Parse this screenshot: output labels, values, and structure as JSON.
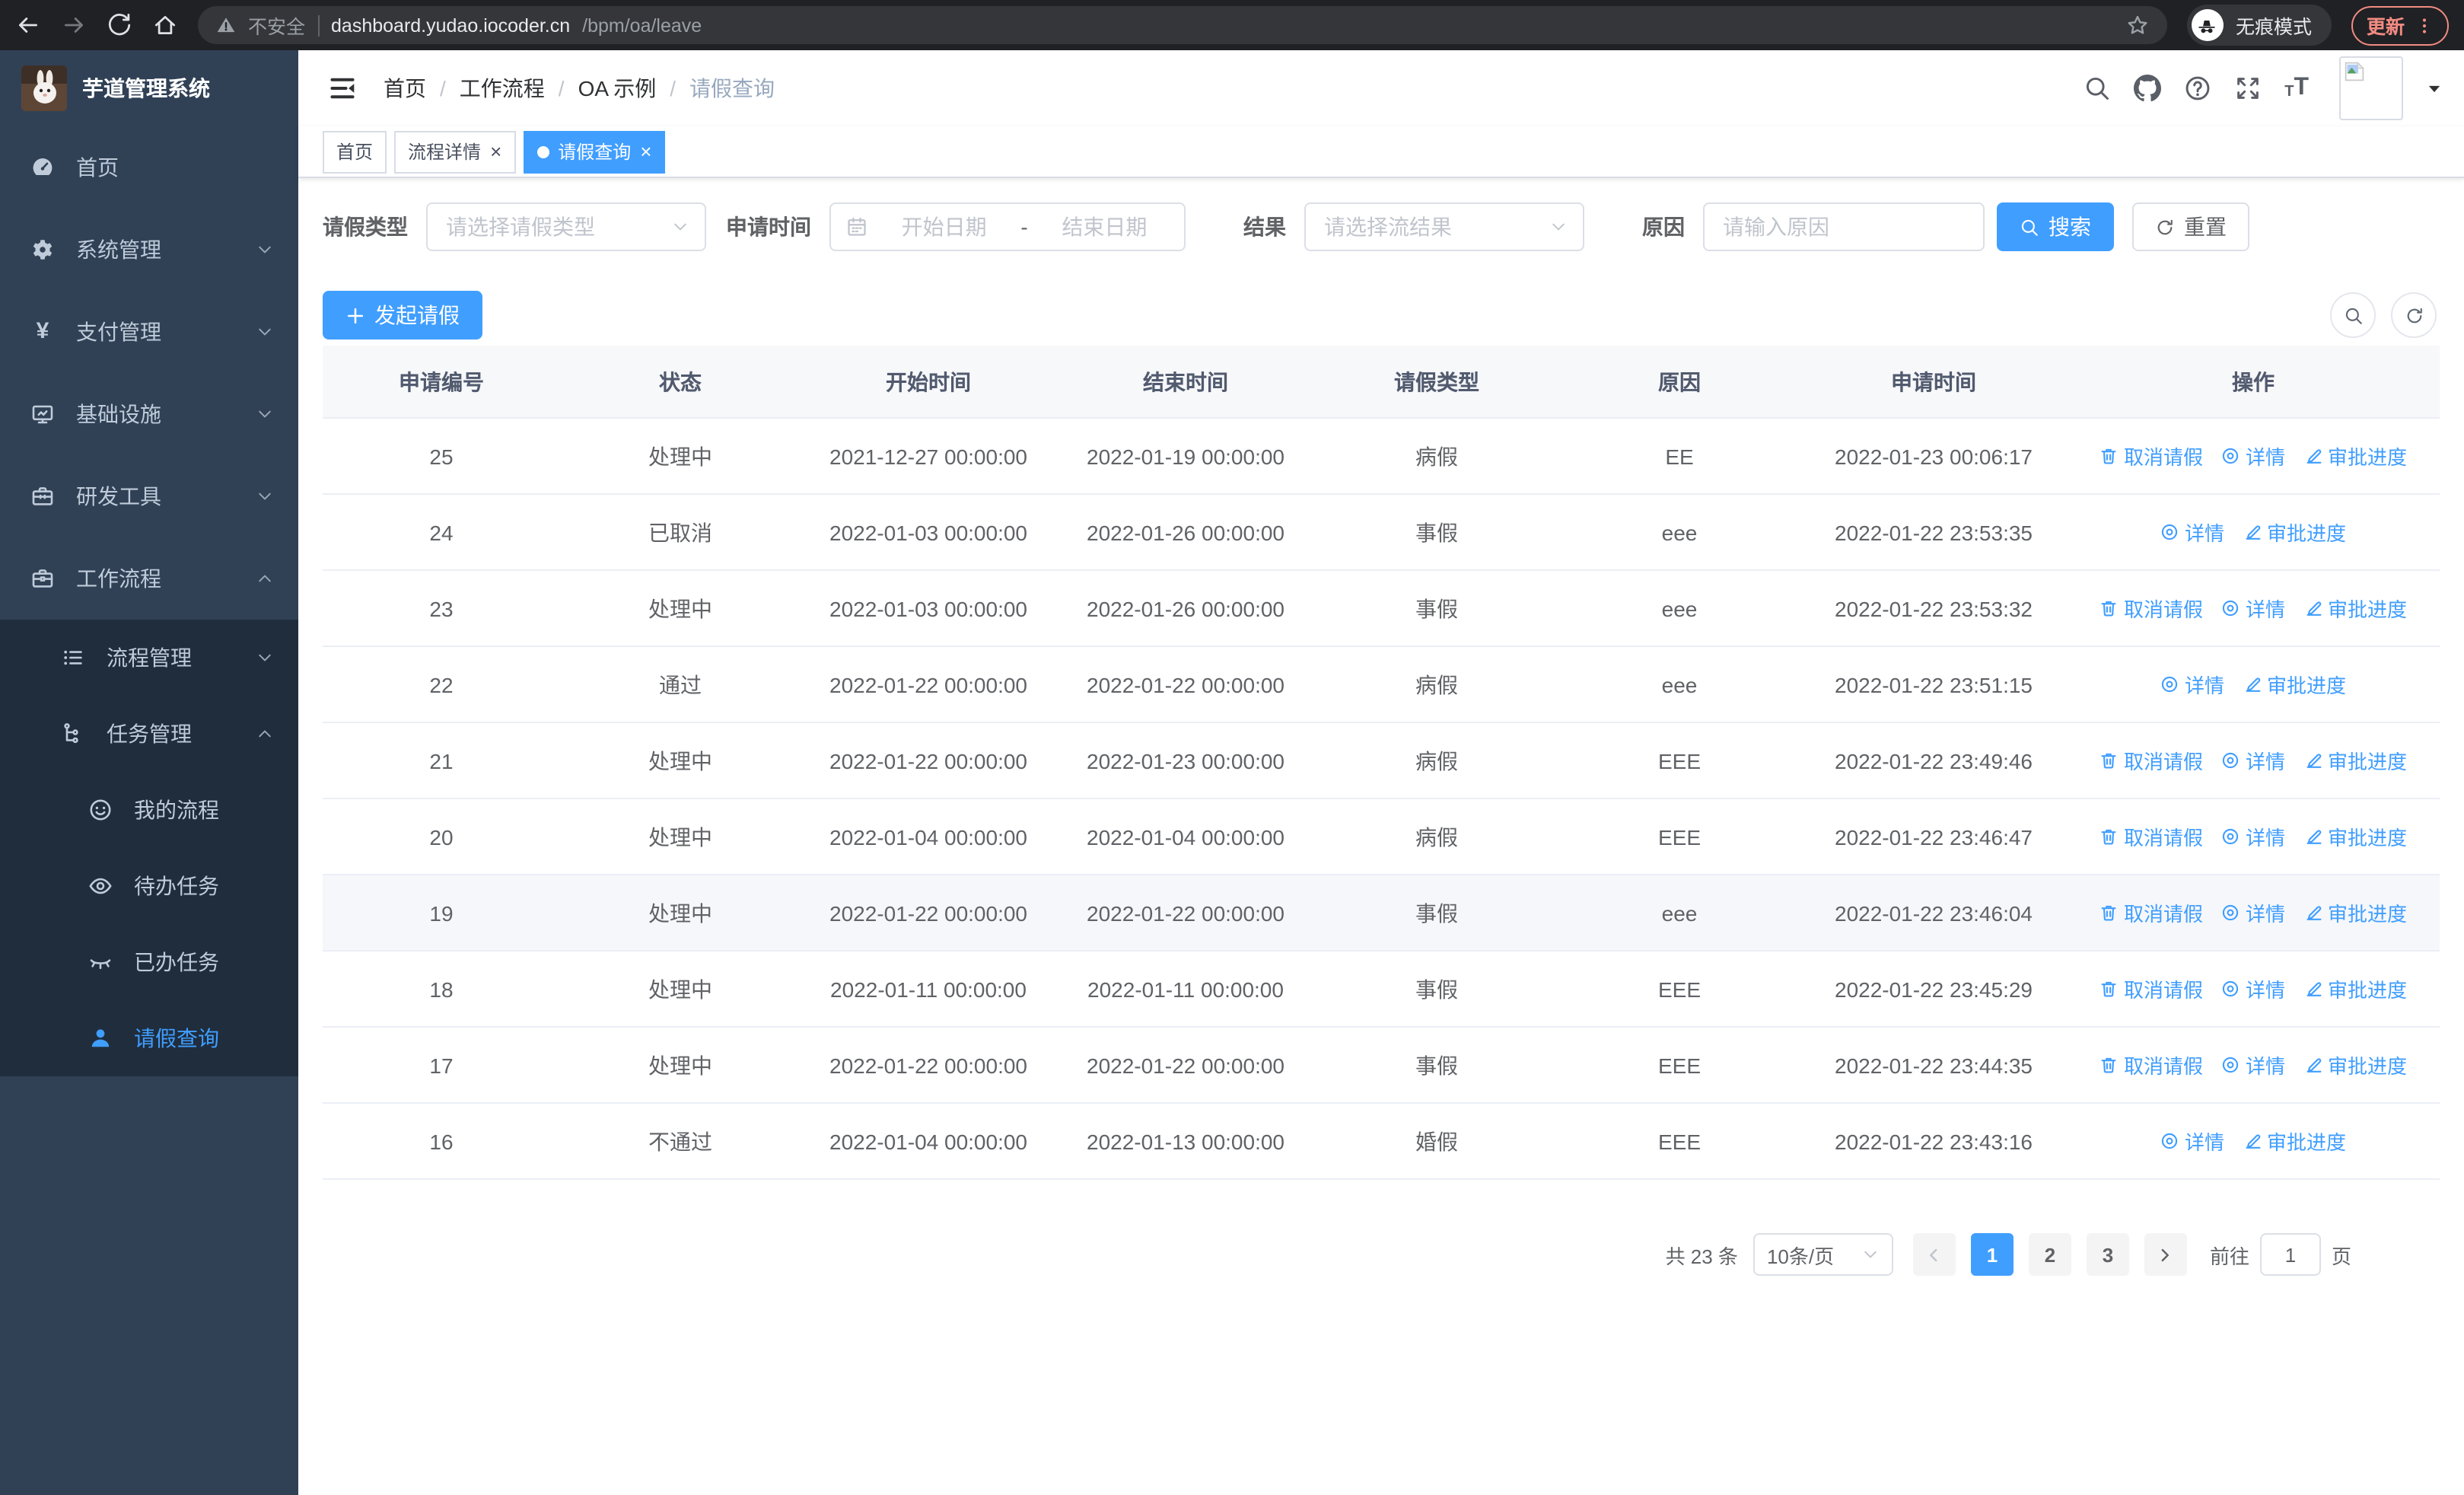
{
  "colors": {
    "accent": "#409eff",
    "sidebar_bg": "#304156",
    "submenu_bg": "#1f2d3d",
    "sidebar_text": "#bfcbd9",
    "update_badge": "#f28b82",
    "table_border": "#ebeef5"
  },
  "browser": {
    "not_secure_label": "不安全",
    "url_host": "dashboard.yudao.iocoder.cn",
    "url_path": "/bpm/oa/leave",
    "incognito_label": "无痕模式",
    "update_label": "更新"
  },
  "sidebar": {
    "title": "芋道管理系统",
    "items": [
      {
        "label": "首页",
        "icon": "dashboard",
        "level": 1
      },
      {
        "label": "系统管理",
        "icon": "gear",
        "level": 1,
        "arrow": "down"
      },
      {
        "label": "支付管理",
        "icon": "yen",
        "level": 1,
        "arrow": "down"
      },
      {
        "label": "基础设施",
        "icon": "monitor",
        "level": 1,
        "arrow": "down"
      },
      {
        "label": "研发工具",
        "icon": "toolbox",
        "level": 1,
        "arrow": "down"
      },
      {
        "label": "工作流程",
        "icon": "briefcase",
        "level": 1,
        "arrow": "up"
      },
      {
        "label": "流程管理",
        "icon": "list",
        "level": 2,
        "sub": true,
        "arrow": "down"
      },
      {
        "label": "任务管理",
        "icon": "tree",
        "level": 2,
        "sub": true,
        "arrow": "up"
      },
      {
        "label": "我的流程",
        "icon": "face",
        "level": 3,
        "sub": true
      },
      {
        "label": "待办任务",
        "icon": "eye",
        "level": 3,
        "sub": true
      },
      {
        "label": "已办任务",
        "icon": "eye-closed",
        "level": 3,
        "sub": true
      },
      {
        "label": "请假查询",
        "icon": "user",
        "level": 3,
        "sub": true,
        "active": true
      }
    ]
  },
  "breadcrumb": [
    {
      "label": "首页"
    },
    {
      "label": "工作流程"
    },
    {
      "label": "OA 示例"
    },
    {
      "label": "请假查询",
      "current": true
    }
  ],
  "tabs": [
    {
      "label": "首页",
      "closable": false,
      "active": false
    },
    {
      "label": "流程详情",
      "closable": true,
      "active": false
    },
    {
      "label": "请假查询",
      "closable": true,
      "active": true
    }
  ],
  "filters": {
    "leave_type_label": "请假类型",
    "leave_type_placeholder": "请选择请假类型",
    "apply_time_label": "申请时间",
    "start_date_placeholder": "开始日期",
    "range_separator": "-",
    "end_date_placeholder": "结束日期",
    "result_label": "结果",
    "result_placeholder": "请选择流结果",
    "reason_label": "原因",
    "reason_placeholder": "请输入原因",
    "search_label": "搜索",
    "reset_label": "重置"
  },
  "toolbar": {
    "create_label": "发起请假"
  },
  "table": {
    "columns": [
      "申请编号",
      "状态",
      "开始时间",
      "结束时间",
      "请假类型",
      "原因",
      "申请时间",
      "操作"
    ],
    "action_defs": {
      "cancel": {
        "label": "取消请假",
        "icon": "delete"
      },
      "detail": {
        "label": "详情",
        "icon": "view"
      },
      "progress": {
        "label": "审批进度",
        "icon": "edit"
      }
    },
    "rows": [
      {
        "id": "25",
        "status": "处理中",
        "start": "2021-12-27 00:00:00",
        "end": "2022-01-19 00:00:00",
        "type": "病假",
        "reason": "EE",
        "apply": "2022-01-23 00:06:17",
        "actions": [
          "cancel",
          "detail",
          "progress"
        ]
      },
      {
        "id": "24",
        "status": "已取消",
        "start": "2022-01-03 00:00:00",
        "end": "2022-01-26 00:00:00",
        "type": "事假",
        "reason": "eee",
        "apply": "2022-01-22 23:53:35",
        "actions": [
          "detail",
          "progress"
        ]
      },
      {
        "id": "23",
        "status": "处理中",
        "start": "2022-01-03 00:00:00",
        "end": "2022-01-26 00:00:00",
        "type": "事假",
        "reason": "eee",
        "apply": "2022-01-22 23:53:32",
        "actions": [
          "cancel",
          "detail",
          "progress"
        ]
      },
      {
        "id": "22",
        "status": "通过",
        "start": "2022-01-22 00:00:00",
        "end": "2022-01-22 00:00:00",
        "type": "病假",
        "reason": "eee",
        "apply": "2022-01-22 23:51:15",
        "actions": [
          "detail",
          "progress"
        ]
      },
      {
        "id": "21",
        "status": "处理中",
        "start": "2022-01-22 00:00:00",
        "end": "2022-01-23 00:00:00",
        "type": "病假",
        "reason": "EEE",
        "apply": "2022-01-22 23:49:46",
        "actions": [
          "cancel",
          "detail",
          "progress"
        ]
      },
      {
        "id": "20",
        "status": "处理中",
        "start": "2022-01-04 00:00:00",
        "end": "2022-01-04 00:00:00",
        "type": "病假",
        "reason": "EEE",
        "apply": "2022-01-22 23:46:47",
        "actions": [
          "cancel",
          "detail",
          "progress"
        ]
      },
      {
        "id": "19",
        "status": "处理中",
        "start": "2022-01-22 00:00:00",
        "end": "2022-01-22 00:00:00",
        "type": "事假",
        "reason": "eee",
        "apply": "2022-01-22 23:46:04",
        "actions": [
          "cancel",
          "detail",
          "progress"
        ],
        "highlighted": true
      },
      {
        "id": "18",
        "status": "处理中",
        "start": "2022-01-11 00:00:00",
        "end": "2022-01-11 00:00:00",
        "type": "事假",
        "reason": "EEE",
        "apply": "2022-01-22 23:45:29",
        "actions": [
          "cancel",
          "detail",
          "progress"
        ]
      },
      {
        "id": "17",
        "status": "处理中",
        "start": "2022-01-22 00:00:00",
        "end": "2022-01-22 00:00:00",
        "type": "事假",
        "reason": "EEE",
        "apply": "2022-01-22 23:44:35",
        "actions": [
          "cancel",
          "detail",
          "progress"
        ]
      },
      {
        "id": "16",
        "status": "不通过",
        "start": "2022-01-04 00:00:00",
        "end": "2022-01-13 00:00:00",
        "type": "婚假",
        "reason": "EEE",
        "apply": "2022-01-22 23:43:16",
        "actions": [
          "detail",
          "progress"
        ]
      }
    ]
  },
  "pagination": {
    "total_label": "共 23 条",
    "page_size_label": "10条/页",
    "pages": [
      "1",
      "2",
      "3"
    ],
    "active_page": "1",
    "goto_label": "前往",
    "goto_value": "1",
    "page_suffix_label": "页"
  }
}
